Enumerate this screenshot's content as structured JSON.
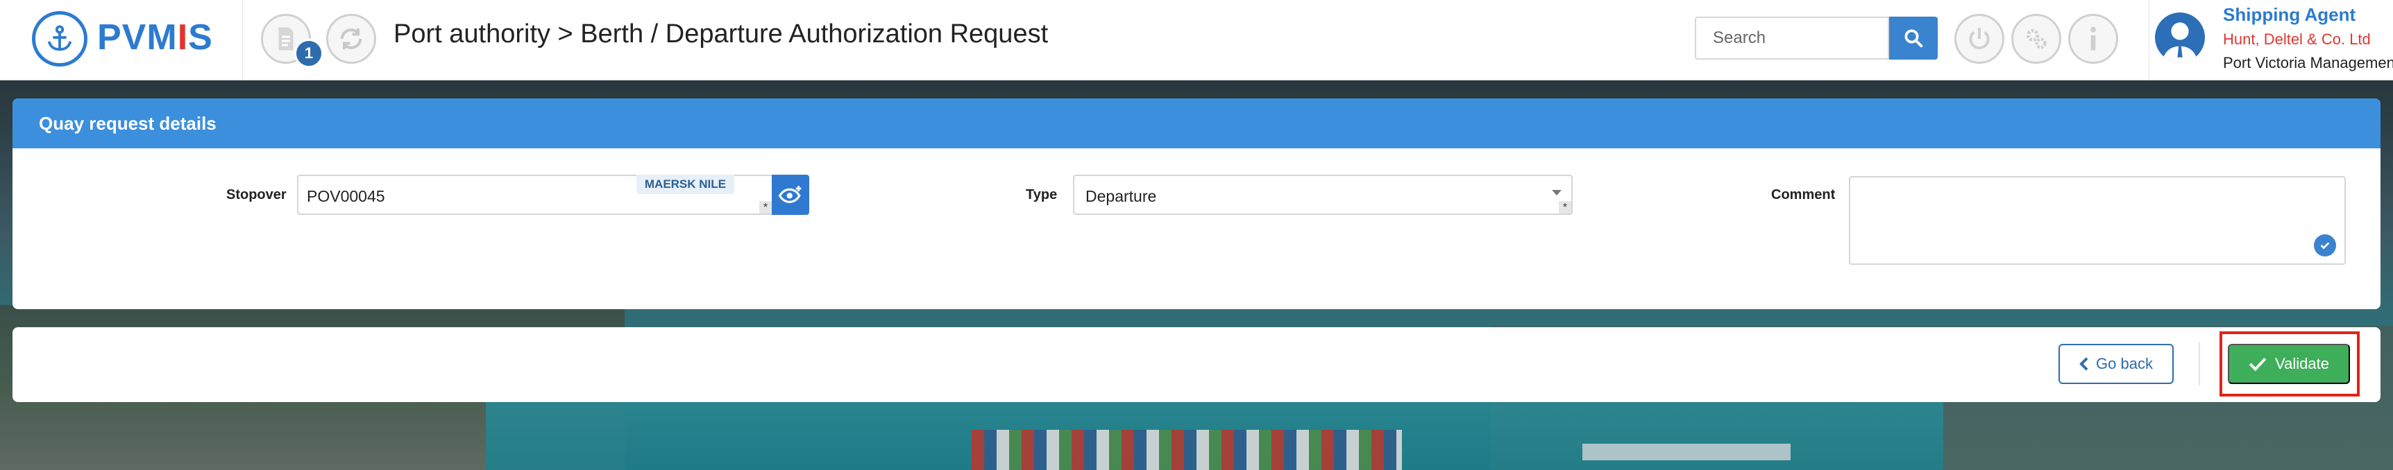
{
  "app": {
    "logo_text_1": "PVM",
    "logo_text_red": "I",
    "logo_text_2": "S"
  },
  "header": {
    "breadcrumb": "Port authority > Berth / Departure Authorization Request",
    "notification_count": "1",
    "search": {
      "placeholder": "Search"
    },
    "user": {
      "role": "Shipping Agent",
      "company": "Hunt, Deltel & Co. Ltd",
      "organization": "Port Victoria Management"
    }
  },
  "panel": {
    "title": "Quay request details",
    "stopover": {
      "label": "Stopover",
      "value": "POV00045",
      "vessel_tag": "MAERSK NILE",
      "required_mark": "*"
    },
    "type": {
      "label": "Type",
      "value": "Departure",
      "required_mark": "*"
    },
    "comment": {
      "label": "Comment",
      "value": ""
    }
  },
  "actions": {
    "back_label": "Go back",
    "validate_label": "Validate"
  },
  "colors": {
    "brand_blue": "#2c7bd1",
    "panel_header": "#3c8fdc",
    "validate_green": "#3fae5a",
    "highlight_red": "#e2231a"
  }
}
